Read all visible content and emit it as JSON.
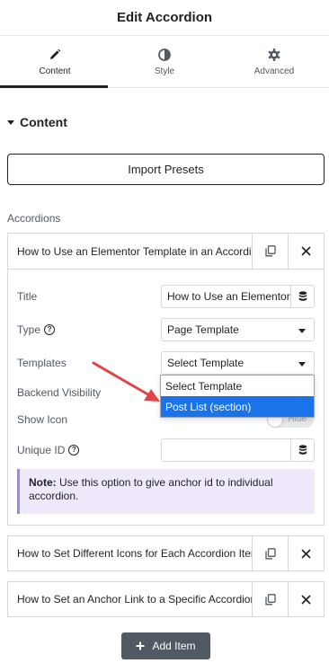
{
  "header": {
    "title": "Edit Accordion"
  },
  "tabs": [
    {
      "label": "Content",
      "icon": "pencil-icon",
      "active": true
    },
    {
      "label": "Style",
      "icon": "half-circle-icon",
      "active": false
    },
    {
      "label": "Advanced",
      "icon": "gear-icon",
      "active": false
    }
  ],
  "section": {
    "title": "Content"
  },
  "import_button": {
    "label": "Import Presets"
  },
  "accordions_label": "Accordions",
  "expanded_item": {
    "title": "How to Use an Elementor Template in an Accordion",
    "fields": {
      "title_label": "Title",
      "title_value": "How to Use an Elementor Template in an Accordion",
      "type_label": "Type",
      "type_value": "Page Template",
      "templates_label": "Templates",
      "templates_value": "Select Template",
      "backend_visibility_label": "Backend Visibility",
      "show_icon_label": "Show Icon",
      "show_icon_toggle": "Hide",
      "unique_id_label": "Unique ID",
      "unique_id_value": ""
    },
    "note_label": "Note:",
    "note_text": " Use this option to give anchor id to individual accordion."
  },
  "templates_dropdown": {
    "options": [
      "Select Template",
      "Post List (section)"
    ],
    "highlighted": "Post List (section)"
  },
  "collapsed_items": [
    {
      "title": "How to Set Different Icons for Each Accordion Item"
    },
    {
      "title": "How to Set an Anchor Link to a Specific Accordion"
    }
  ],
  "add_item": {
    "label": "Add Item"
  },
  "colors": {
    "accent_highlight": "#1a73e8",
    "annotation_arrow": "#e04545",
    "note_background": "#efe9fb",
    "add_button": "#515962"
  }
}
